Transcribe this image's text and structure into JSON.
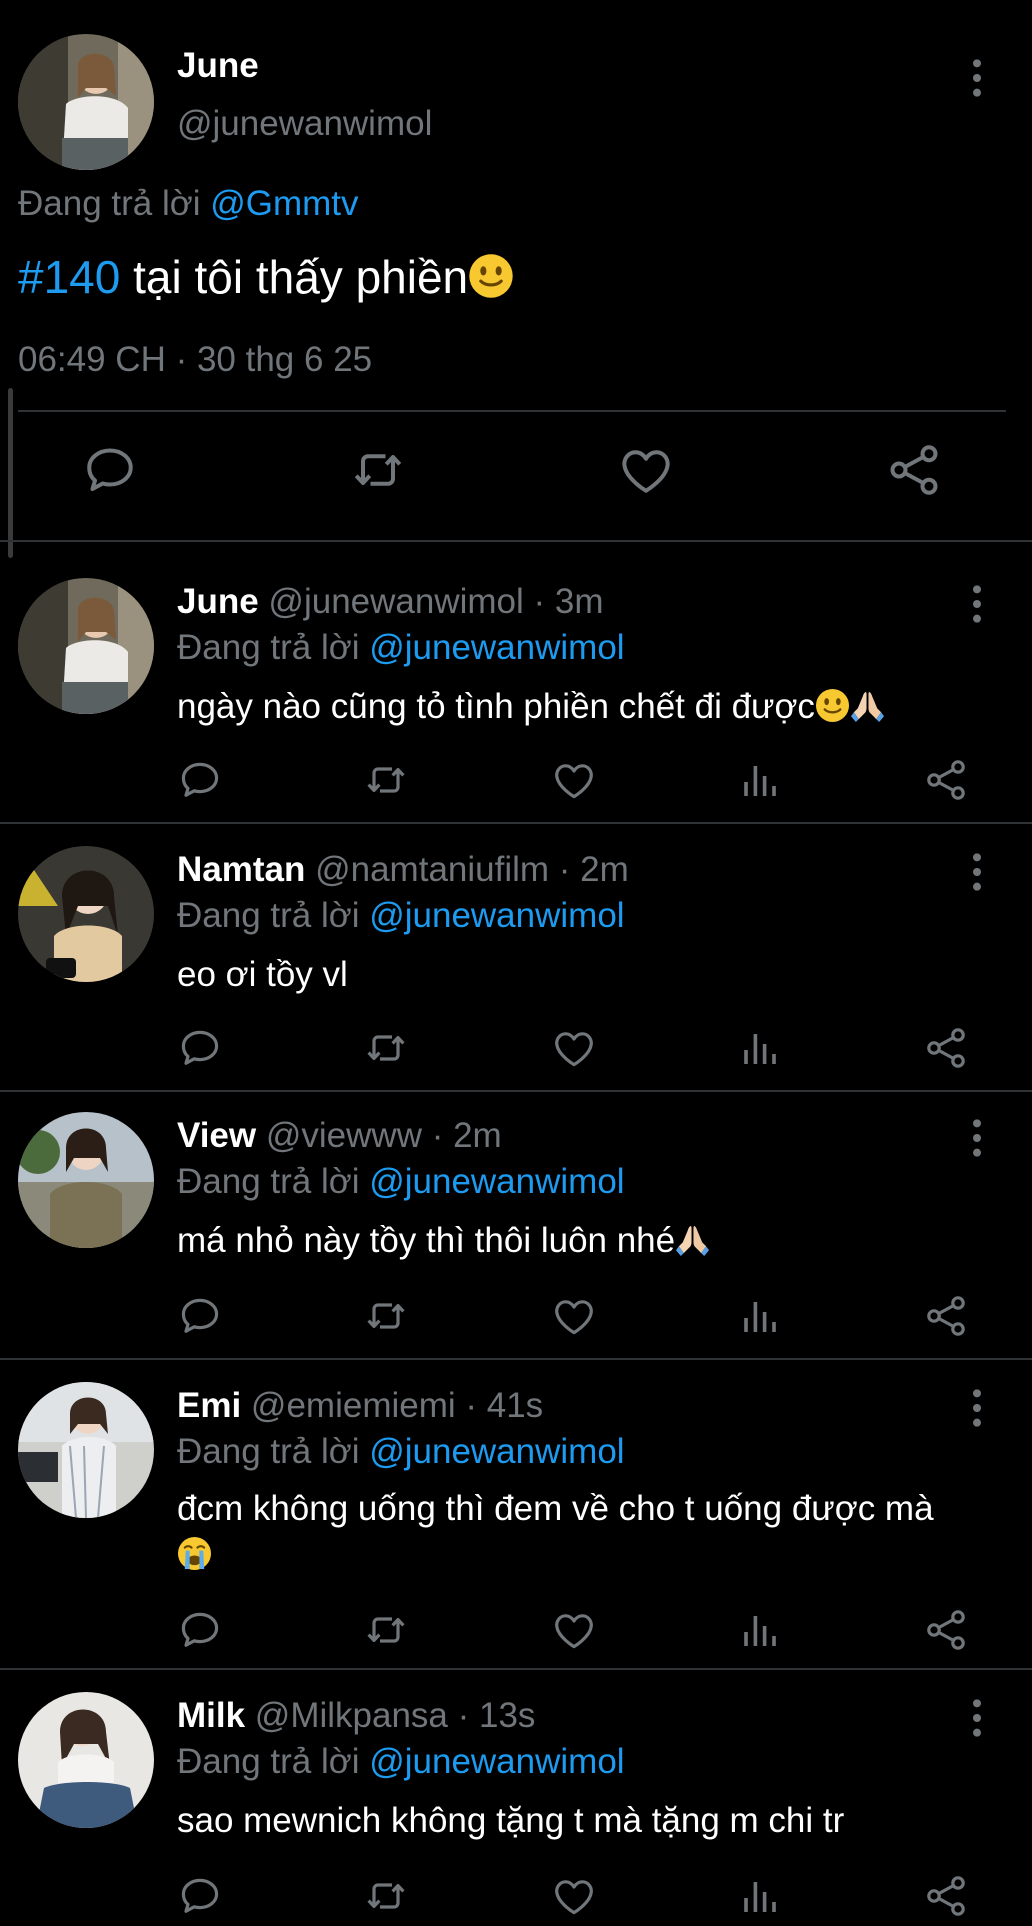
{
  "main_tweet": {
    "name": "June",
    "handle": "@junewanwimol",
    "reply_prefix": "Đang trả lời",
    "reply_to": "@Gmmtv",
    "hashtag": "#140",
    "text": " tại tôi thấy phiền",
    "text_emoji": "slightly-smiling-face-emoji",
    "timestamp": "06:49 CH · 30 thg 6 25",
    "actions": [
      "reply-icon",
      "retweet-icon",
      "like-icon",
      "share-icon"
    ]
  },
  "replies": [
    {
      "name": "June",
      "meta": " @junewanwimol · 3m",
      "reply_prefix": "Đang trả lời ",
      "reply_to": "@junewanwimol",
      "text": "ngày nào cũng tỏ tình phiền chết đi được",
      "emojis": [
        "slightly-smiling-face-emoji",
        "folded-hands-emoji"
      ]
    },
    {
      "name": "Namtan",
      "meta": " @namtaniufilm · 2m",
      "reply_prefix": "Đang trả lời ",
      "reply_to": "@junewanwimol",
      "text": "eo ơi tồy vl",
      "emojis": []
    },
    {
      "name": "View",
      "meta": " @viewww · 2m",
      "reply_prefix": "Đang trả lời ",
      "reply_to": "@junewanwimol",
      "text": "má nhỏ này tồy thì thôi luôn nhé",
      "emojis": [
        "folded-hands-emoji"
      ]
    },
    {
      "name": "Emi",
      "meta": " @emiemiemi · 41s",
      "reply_prefix": "Đang trả lời ",
      "reply_to": "@junewanwimol",
      "text": "đcm không uống thì đem về cho t uống được mà",
      "emojis": [
        "loudly-crying-face-emoji"
      ]
    },
    {
      "name": "Milk",
      "meta": " @Milkpansa · 13s",
      "reply_prefix": "Đang trả lời ",
      "reply_to": "@junewanwimol",
      "text": "sao mewnich không tặng t mà tặng m chi tr",
      "emojis": []
    }
  ],
  "reply_actions": [
    "reply-icon",
    "retweet-icon",
    "like-icon",
    "views-icon",
    "share-icon"
  ],
  "colors": {
    "background": "#000000",
    "text": "#e7e9ea",
    "muted": "#71767b",
    "link": "#1d9bf0",
    "divider": "#2f3336",
    "emoji": "#f7c82f"
  }
}
